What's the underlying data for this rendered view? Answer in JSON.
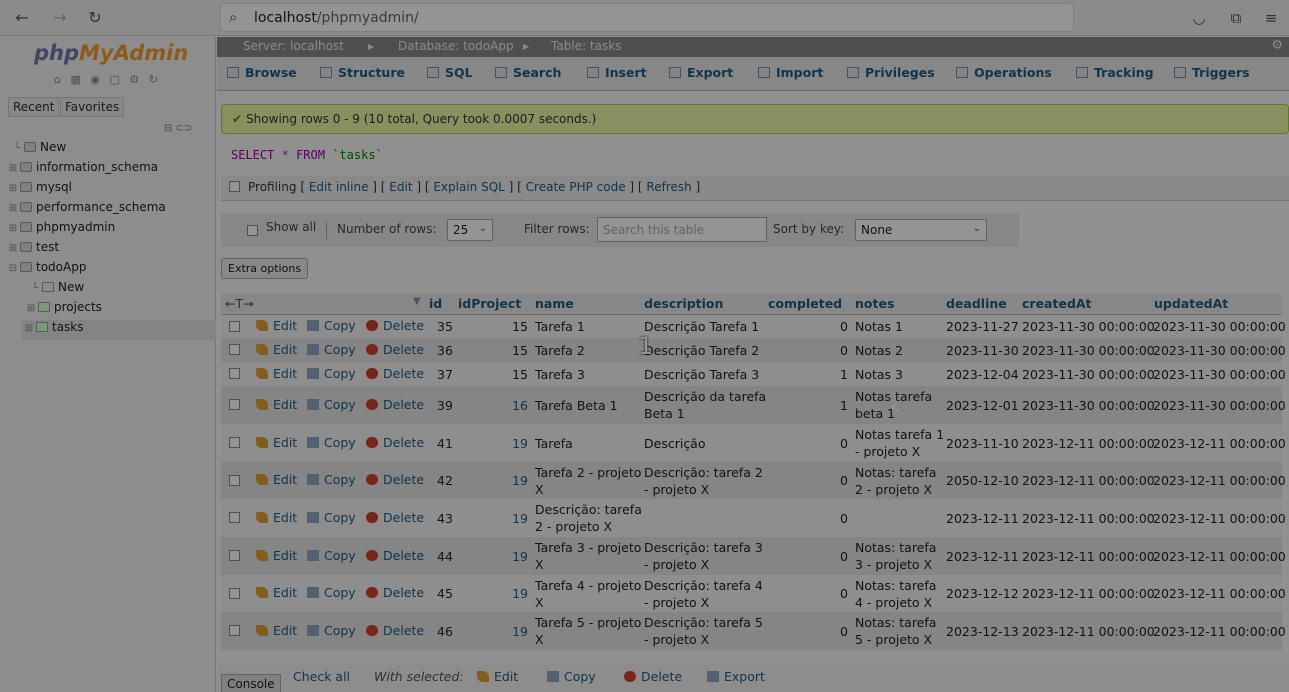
{
  "browser": {
    "url_host": "localhost",
    "url_path": "/phpmyadmin/"
  },
  "logo": {
    "php": "php",
    "my": "MyAdmin"
  },
  "nav_tabs": [
    "Recent",
    "Favorites"
  ],
  "tree": [
    {
      "label": "New",
      "level": 0
    },
    {
      "label": "information_schema",
      "level": 0
    },
    {
      "label": "mysql",
      "level": 0
    },
    {
      "label": "performance_schema",
      "level": 0
    },
    {
      "label": "phpmyadmin",
      "level": 0
    },
    {
      "label": "test",
      "level": 0
    },
    {
      "label": "todoApp",
      "level": 0
    },
    {
      "label": "New",
      "level": 1
    },
    {
      "label": "projects",
      "level": 1
    },
    {
      "label": "tasks",
      "level": 1
    }
  ],
  "breadcrumb": {
    "server": "Server: localhost",
    "database": "Database: todoApp",
    "table": "Table: tasks"
  },
  "tabs": [
    "Browse",
    "Structure",
    "SQL",
    "Search",
    "Insert",
    "Export",
    "Import",
    "Privileges",
    "Operations",
    "Tracking",
    "Triggers"
  ],
  "message": "Showing rows 0 - 9 (10 total, Query took 0.0007 seconds.)",
  "sql": {
    "select": "SELECT",
    "star": "*",
    "from": "FROM",
    "table": "`tasks`"
  },
  "profiling": {
    "label": "Profiling",
    "links": [
      "Edit inline",
      "Edit",
      "Explain SQL",
      "Create PHP code",
      "Refresh"
    ]
  },
  "nav": {
    "show_all": "Show all",
    "num_rows_label": "Number of rows:",
    "num_rows_value": "25",
    "filter_label": "Filter rows:",
    "filter_placeholder": "Search this table",
    "sort_label": "Sort by key:",
    "sort_value": "None"
  },
  "extra_options": "Extra options",
  "arrows": "←T→",
  "columns": [
    "id",
    "idProject",
    "name",
    "description",
    "completed",
    "notes",
    "deadline",
    "createdAt",
    "updatedAt"
  ],
  "actions": {
    "edit": "Edit",
    "copy": "Copy",
    "delete": "Delete"
  },
  "rows": [
    {
      "id": "35",
      "idProject": "15",
      "name": [
        "Tarefa 1"
      ],
      "description": [
        "Descrição Tarefa 1"
      ],
      "completed": "0",
      "notes": [
        "Notas 1"
      ],
      "deadline": "2023-11-27",
      "createdAt": "2023-11-30 00:00:00",
      "updatedAt": "2023-11-30 00:00:00"
    },
    {
      "id": "36",
      "idProject": "15",
      "name": [
        "Tarefa 2"
      ],
      "description": [
        "Descrição Tarefa 2"
      ],
      "completed": "0",
      "notes": [
        "Notas 2"
      ],
      "deadline": "2023-11-30",
      "createdAt": "2023-11-30 00:00:00",
      "updatedAt": "2023-11-30 00:00:00"
    },
    {
      "id": "37",
      "idProject": "15",
      "name": [
        "Tarefa 3"
      ],
      "description": [
        "Descrição Tarefa 3"
      ],
      "completed": "1",
      "notes": [
        "Notas 3"
      ],
      "deadline": "2023-12-04",
      "createdAt": "2023-11-30 00:00:00",
      "updatedAt": "2023-11-30 00:00:00"
    },
    {
      "id": "39",
      "idProject": "16",
      "name": [
        "Tarefa Beta 1"
      ],
      "description": [
        "Descrição da tarefa",
        "Beta 1"
      ],
      "completed": "1",
      "notes": [
        "Notas tarefa",
        "beta 1"
      ],
      "deadline": "2023-12-01",
      "createdAt": "2023-11-30 00:00:00",
      "updatedAt": "2023-11-30 00:00:00"
    },
    {
      "id": "41",
      "idProject": "19",
      "name": [
        "Tarefa"
      ],
      "description": [
        "Descrição"
      ],
      "completed": "0",
      "notes": [
        "Notas tarefa 1",
        "- projeto X"
      ],
      "deadline": "2023-11-10",
      "createdAt": "2023-12-11 00:00:00",
      "updatedAt": "2023-12-11 00:00:00"
    },
    {
      "id": "42",
      "idProject": "19",
      "name": [
        "Tarefa 2 - projeto",
        "X"
      ],
      "description": [
        "Descrição: tarefa 2",
        "- projeto X"
      ],
      "completed": "0",
      "notes": [
        "Notas: tarefa",
        "2 - projeto X"
      ],
      "deadline": "2050-12-10",
      "createdAt": "2023-12-11 00:00:00",
      "updatedAt": "2023-12-11 00:00:00"
    },
    {
      "id": "43",
      "idProject": "19",
      "name": [
        "Descrição: tarefa",
        "2 - projeto X"
      ],
      "description": [
        ""
      ],
      "completed": "0",
      "notes": [
        ""
      ],
      "deadline": "2023-12-11",
      "createdAt": "2023-12-11 00:00:00",
      "updatedAt": "2023-12-11 00:00:00"
    },
    {
      "id": "44",
      "idProject": "19",
      "name": [
        "Tarefa 3 - projeto",
        "X"
      ],
      "description": [
        "Descrição: tarefa 3",
        "- projeto X"
      ],
      "completed": "0",
      "notes": [
        "Notas: tarefa",
        "3 - projeto X"
      ],
      "deadline": "2023-12-11",
      "createdAt": "2023-12-11 00:00:00",
      "updatedAt": "2023-12-11 00:00:00"
    },
    {
      "id": "45",
      "idProject": "19",
      "name": [
        "Tarefa 4 - projeto",
        "X"
      ],
      "description": [
        "Descrição: tarefa 4",
        "- projeto X"
      ],
      "completed": "0",
      "notes": [
        "Notas: tarefa",
        "4 - projeto X"
      ],
      "deadline": "2023-12-12",
      "createdAt": "2023-12-11 00:00:00",
      "updatedAt": "2023-12-11 00:00:00"
    },
    {
      "id": "46",
      "idProject": "19",
      "name": [
        "Tarefa 5 - projeto",
        "X"
      ],
      "description": [
        "Descrição: tarefa 5",
        "- projeto X"
      ],
      "completed": "0",
      "notes": [
        "Notas: tarefa",
        "5 - projeto X"
      ],
      "deadline": "2023-12-13",
      "createdAt": "2023-12-11 00:00:00",
      "updatedAt": "2023-12-11 00:00:00"
    }
  ],
  "footer": {
    "check_all": "Check all",
    "with_selected": "With selected:",
    "edit": "Edit",
    "copy": "Copy",
    "delete": "Delete",
    "export": "Export",
    "console": "Console"
  },
  "overlay_number": "1"
}
